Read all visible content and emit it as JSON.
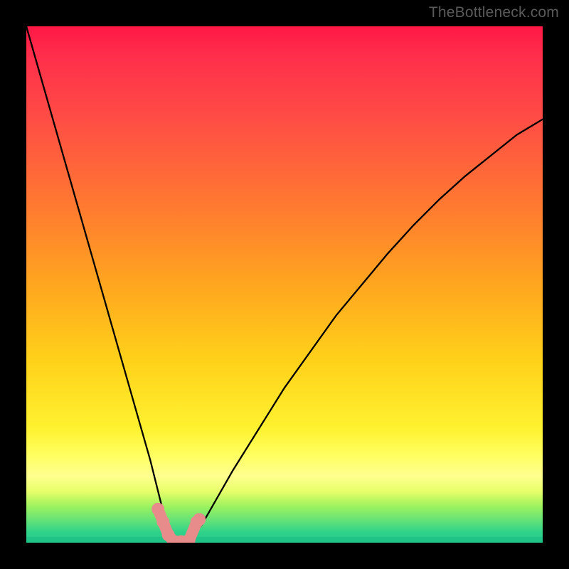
{
  "watermark": "TheBottleneck.com",
  "chart_data": {
    "type": "line",
    "title": "",
    "xlabel": "",
    "ylabel": "",
    "xlim": [
      0,
      100
    ],
    "ylim": [
      0,
      100
    ],
    "grid": false,
    "legend": false,
    "curve": {
      "name": "bottleneck-curve",
      "x": [
        0,
        2,
        4,
        6,
        8,
        10,
        12,
        14,
        16,
        18,
        20,
        22,
        24,
        25,
        26,
        27,
        28,
        29,
        30,
        31,
        32,
        34,
        36,
        40,
        45,
        50,
        55,
        60,
        65,
        70,
        75,
        80,
        85,
        90,
        95,
        100
      ],
      "y": [
        100,
        93,
        86,
        79,
        72,
        65,
        58,
        51,
        44,
        37,
        30,
        23,
        16,
        12,
        8,
        4.5,
        2,
        0.5,
        0,
        0.2,
        1,
        3.5,
        7,
        14,
        22,
        30,
        37,
        44,
        50,
        56,
        61.5,
        66.5,
        71,
        75,
        79,
        82
      ]
    },
    "markers": {
      "name": "data-markers",
      "color": "#e88b8b",
      "points": [
        {
          "x": 25.5,
          "y": 6.5
        },
        {
          "x": 26.5,
          "y": 4.0
        },
        {
          "x": 27.5,
          "y": 1.5
        },
        {
          "x": 28.5,
          "y": 0.3
        },
        {
          "x": 30.0,
          "y": 0.2
        },
        {
          "x": 31.5,
          "y": 0.4
        },
        {
          "x": 33.0,
          "y": 4.0
        },
        {
          "x": 33.5,
          "y": 4.5
        }
      ]
    },
    "background_gradient": {
      "top": "#ff1846",
      "mid1": "#ff7a30",
      "mid2": "#ffd21a",
      "mid3": "#ffff60",
      "bottom": "#21c487"
    }
  }
}
